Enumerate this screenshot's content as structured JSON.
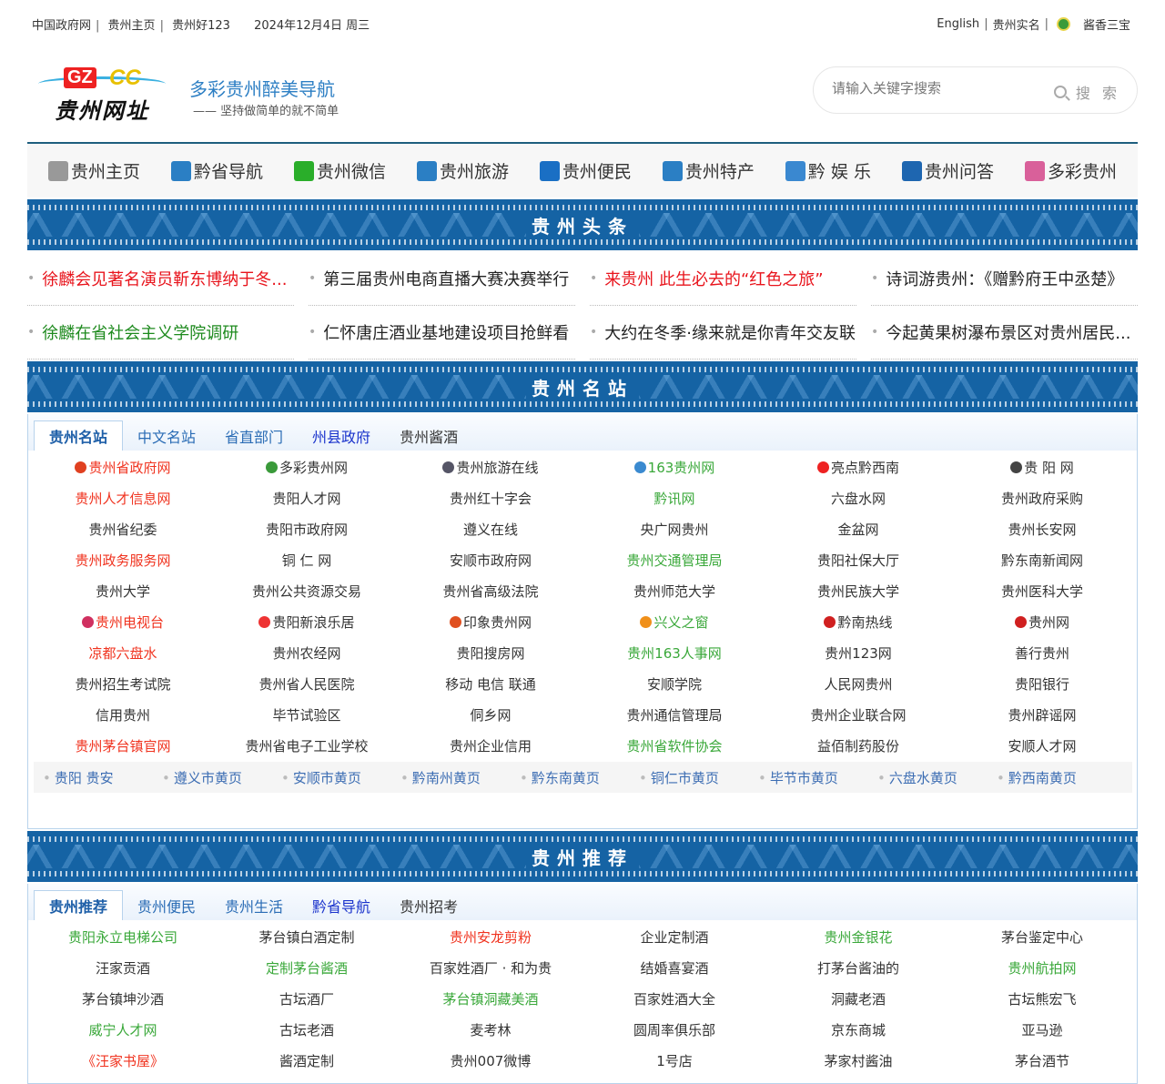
{
  "topbar": {
    "links": [
      "中国政府网",
      "贵州主页",
      "贵州好123"
    ],
    "date": "2024年12月4日 周三",
    "right_links": [
      "English",
      "贵州实名"
    ],
    "right_brand": "酱香三宝"
  },
  "logo": {
    "gz": "GZ",
    "cc": "CC",
    "cn": "贵州网址"
  },
  "header": {
    "slogan": "多彩贵州醉美导航",
    "subslogan": "—— 坚持做简单的就不简单"
  },
  "search": {
    "placeholder": "请输入关键字搜索",
    "button": "搜 索"
  },
  "nav": [
    {
      "label": "贵州主页",
      "icon": "pagoda-icon",
      "color": "#999"
    },
    {
      "label": "黔省导航",
      "icon": "building-icon",
      "color": "#2b7fc4"
    },
    {
      "label": "贵州微信",
      "icon": "wechat-icon",
      "color": "#2aae2a"
    },
    {
      "label": "贵州旅游",
      "icon": "travel-icon",
      "color": "#2b7fc4"
    },
    {
      "label": "贵州便民",
      "icon": "tools-icon",
      "color": "#1a6fc4"
    },
    {
      "label": "贵州特产",
      "icon": "cart-icon",
      "color": "#2b7fc4"
    },
    {
      "label": "黔 娱 乐",
      "icon": "music-icon",
      "color": "#3a88d0"
    },
    {
      "label": "贵州问答",
      "icon": "qa-icon",
      "color": "#1e66b0"
    },
    {
      "label": "多彩贵州",
      "icon": "map-icon",
      "color": "#d9609a"
    }
  ],
  "banners": {
    "news": "贵州头条",
    "sites": "贵州名站",
    "recommend": "贵州推荐"
  },
  "news": [
    {
      "text": "徐麟会见著名演员靳东博纳于冬...",
      "color": "#e8141c"
    },
    {
      "text": "第三届贵州电商直播大赛决赛举行",
      "color": "#222"
    },
    {
      "text": "来贵州 此生必去的“红色之旅”",
      "color": "#e8141c"
    },
    {
      "text": "诗词游贵州：《赠黔府王中丞楚》",
      "color": "#222"
    },
    {
      "text": "徐麟在省社会主义学院调研",
      "color": "#1e8a1e"
    },
    {
      "text": "仁怀唐庄酒业基地建设项目抢鲜看",
      "color": "#222"
    },
    {
      "text": "大约在冬季·缘来就是你青年交友联",
      "color": "#222"
    },
    {
      "text": "今起黄果树瀑布景区对贵州居民...",
      "color": "#222"
    }
  ],
  "sites": {
    "tabs": [
      "贵州名站",
      "中文名站",
      "省直部门",
      "州县政府",
      "贵州酱酒"
    ],
    "links": [
      {
        "t": "贵州省政府网",
        "c": "red",
        "i": "#e04020"
      },
      {
        "t": "多彩贵州网",
        "c": "",
        "i": "#3a9a3a"
      },
      {
        "t": "贵州旅游在线",
        "c": "",
        "i": "#556"
      },
      {
        "t": "163贵州网",
        "c": "green",
        "i": "#3a8ad0"
      },
      {
        "t": "亮点黔西南",
        "c": "",
        "i": "#e22"
      },
      {
        "t": "贵 阳 网",
        "c": "",
        "i": "#444"
      },
      {
        "t": "贵州人才信息网",
        "c": "red"
      },
      {
        "t": "贵阳人才网",
        "c": ""
      },
      {
        "t": "贵州红十字会",
        "c": ""
      },
      {
        "t": "黔讯网",
        "c": "green"
      },
      {
        "t": "六盘水网",
        "c": ""
      },
      {
        "t": "贵州政府采购",
        "c": ""
      },
      {
        "t": "贵州省纪委",
        "c": ""
      },
      {
        "t": "贵阳市政府网",
        "c": ""
      },
      {
        "t": "遵义在线",
        "c": ""
      },
      {
        "t": "央广网贵州",
        "c": ""
      },
      {
        "t": "金盆网",
        "c": ""
      },
      {
        "t": "贵州长安网",
        "c": ""
      },
      {
        "t": "贵州政务服务网",
        "c": "red"
      },
      {
        "t": "铜 仁 网",
        "c": ""
      },
      {
        "t": "安顺市政府网",
        "c": ""
      },
      {
        "t": "贵州交通管理局",
        "c": "green"
      },
      {
        "t": "贵阳社保大厅",
        "c": ""
      },
      {
        "t": "黔东南新闻网",
        "c": ""
      },
      {
        "t": "贵州大学",
        "c": ""
      },
      {
        "t": "贵州公共资源交易",
        "c": ""
      },
      {
        "t": "贵州省高级法院",
        "c": ""
      },
      {
        "t": "贵州师范大学",
        "c": ""
      },
      {
        "t": "贵州民族大学",
        "c": ""
      },
      {
        "t": "贵州医科大学",
        "c": ""
      },
      {
        "t": "贵州电视台",
        "c": "red",
        "i": "#d03060"
      },
      {
        "t": "贵阳新浪乐居",
        "c": "",
        "i": "#e33"
      },
      {
        "t": "印象贵州网",
        "c": "",
        "i": "#e05020"
      },
      {
        "t": "兴义之窗",
        "c": "green",
        "i": "#f0901a"
      },
      {
        "t": "黔南热线",
        "c": "",
        "i": "#d02020"
      },
      {
        "t": "贵州网",
        "c": "",
        "i": "#d02020"
      },
      {
        "t": "凉都六盘水",
        "c": "red"
      },
      {
        "t": "贵州农经网",
        "c": ""
      },
      {
        "t": "贵阳搜房网",
        "c": ""
      },
      {
        "t": "贵州163人事网",
        "c": "green"
      },
      {
        "t": "贵州123网",
        "c": ""
      },
      {
        "t": "善行贵州",
        "c": ""
      },
      {
        "t": "贵州招生考试院",
        "c": ""
      },
      {
        "t": "贵州省人民医院",
        "c": ""
      },
      {
        "t": "移动 电信 联通",
        "c": ""
      },
      {
        "t": "安顺学院",
        "c": ""
      },
      {
        "t": "人民网贵州",
        "c": ""
      },
      {
        "t": "贵阳银行",
        "c": ""
      },
      {
        "t": "信用贵州",
        "c": ""
      },
      {
        "t": "毕节试验区",
        "c": ""
      },
      {
        "t": "侗乡网",
        "c": ""
      },
      {
        "t": "贵州通信管理局",
        "c": ""
      },
      {
        "t": "贵州企业联合网",
        "c": ""
      },
      {
        "t": "贵州辟谣网",
        "c": ""
      },
      {
        "t": "贵州茅台镇官网",
        "c": "red"
      },
      {
        "t": "贵州省电子工业学校",
        "c": ""
      },
      {
        "t": "贵州企业信用",
        "c": ""
      },
      {
        "t": "贵州省软件协会",
        "c": "green"
      },
      {
        "t": "益佰制药股份",
        "c": ""
      },
      {
        "t": "安顺人才网",
        "c": ""
      }
    ],
    "yellow_pages": [
      "贵阳 贵安",
      "遵义市黄页",
      "安顺市黄页",
      "黔南州黄页",
      "黔东南黄页",
      "铜仁市黄页",
      "毕节市黄页",
      "六盘水黄页",
      "黔西南黄页"
    ]
  },
  "recommend": {
    "tabs": [
      "贵州推荐",
      "贵州便民",
      "贵州生活",
      "黔省导航",
      "贵州招考"
    ],
    "links": [
      {
        "t": "贵阳永立电梯公司",
        "c": "green"
      },
      {
        "t": "茅台镇白酒定制",
        "c": ""
      },
      {
        "t": "贵州安龙剪粉",
        "c": "red"
      },
      {
        "t": "企业定制酒",
        "c": ""
      },
      {
        "t": "贵州金银花",
        "c": "green"
      },
      {
        "t": "茅台鉴定中心",
        "c": ""
      },
      {
        "t": "汪家贡酒",
        "c": ""
      },
      {
        "t": "定制茅台酱酒",
        "c": "green"
      },
      {
        "t": "百家姓酒厂 · 和为贵",
        "c": ""
      },
      {
        "t": "结婚喜宴酒",
        "c": ""
      },
      {
        "t": "打茅台酱油的",
        "c": ""
      },
      {
        "t": "贵州航拍网",
        "c": "green"
      },
      {
        "t": "茅台镇坤沙酒",
        "c": ""
      },
      {
        "t": "古坛酒厂",
        "c": ""
      },
      {
        "t": "茅台镇洞藏美酒",
        "c": "green"
      },
      {
        "t": "百家姓酒大全",
        "c": ""
      },
      {
        "t": "洞藏老酒",
        "c": ""
      },
      {
        "t": "古坛熊宏飞",
        "c": ""
      },
      {
        "t": "威宁人才网",
        "c": "green"
      },
      {
        "t": "古坛老酒",
        "c": ""
      },
      {
        "t": "麦考林",
        "c": ""
      },
      {
        "t": "圆周率俱乐部",
        "c": ""
      },
      {
        "t": "京东商城",
        "c": ""
      },
      {
        "t": "亚马逊",
        "c": ""
      },
      {
        "t": "《汪家书屋》",
        "c": "red"
      },
      {
        "t": "酱酒定制",
        "c": ""
      },
      {
        "t": "贵州007微博",
        "c": ""
      },
      {
        "t": "1号店",
        "c": ""
      },
      {
        "t": "茅家村酱油",
        "c": ""
      },
      {
        "t": "茅台酒节",
        "c": ""
      }
    ]
  }
}
